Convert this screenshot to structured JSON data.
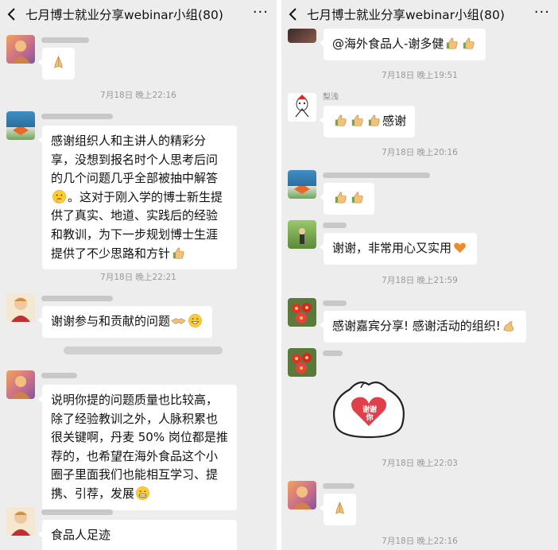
{
  "header": {
    "title": "七月博士就业分享webinar小组(80)",
    "back_icon": "chevron-left-icon",
    "more_icon": "more-dots-icon",
    "more_glyph": "···"
  },
  "left_pane": {
    "timestamps": [
      "7月18日 晚上22:16",
      "7月18日 晚上22:21"
    ],
    "messages": [
      {
        "emoji": "folded-hands"
      },
      {
        "text": "感谢组织人和主讲人的精彩分享，没想到报名时个人思考后问的几个问题几乎全部被抽中解答",
        "text_after": "。这对于刚入学的博士新生提供了真实、地道、实践后的经验和教训，为下一步规划博士生涯提供了不少思路和方针",
        "emojis": [
          "thinking-face",
          "thumbs-up"
        ]
      },
      {
        "text": "谢谢参与和贡献的问题",
        "emojis": [
          "handshake",
          "grinning-face"
        ]
      },
      {
        "text": "说明你提的问题质量也比较高，除了经验教训之外，人脉积累也很关键啊，丹麦 50% 岗位都是推荐的，也希望在海外食品这个小圈子里面我们也能相互学习、提携、引荐，发展",
        "emojis": [
          "grin-teeth"
        ]
      },
      {
        "text": "食品人足迹"
      }
    ]
  },
  "right_pane": {
    "timestamps": [
      "7月18日 晚上19:51",
      "7月18日 晚上20:16",
      "7月18日 晚上21:59",
      "7月18日 晚上22:03",
      "7月18日 晚上22:16"
    ],
    "messages": [
      {
        "text": "@海外食品人-谢多健",
        "emojis": [
          "thumbs-up",
          "thumbs-up"
        ]
      },
      {
        "sender": "梨浅",
        "text": "感谢",
        "emojis": [
          "thumbs-up",
          "thumbs-up",
          "thumbs-up"
        ]
      },
      {
        "emojis": [
          "thumbs-up",
          "thumbs-up"
        ]
      },
      {
        "text": "谢谢，非常用心又实用",
        "emojis": [
          "orange-heart"
        ]
      },
      {
        "text": "感谢嘉宾分享! 感谢活动的组织!",
        "emojis": [
          "flexed-bicep"
        ]
      },
      {
        "sticker": "xie-xie-ni-sticker",
        "sticker_chars": [
          "谢",
          "谢",
          "你"
        ]
      },
      {
        "emoji": "folded-hands"
      }
    ]
  }
}
